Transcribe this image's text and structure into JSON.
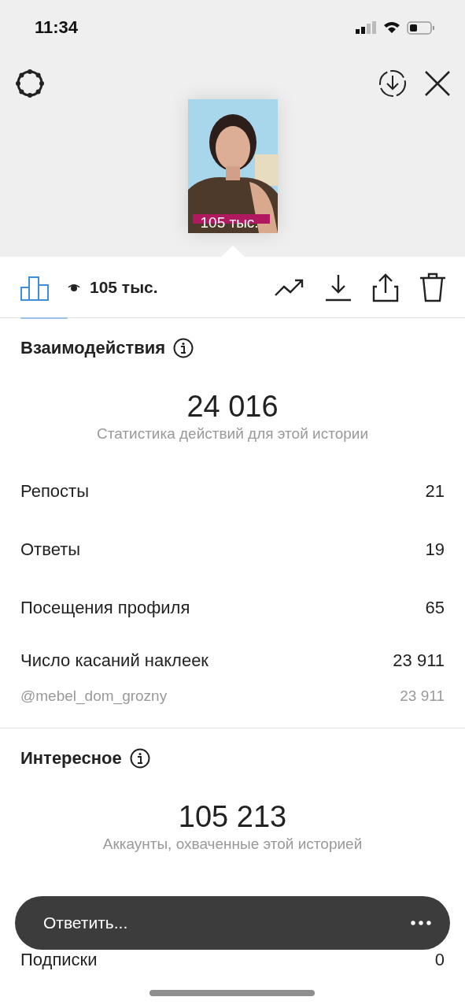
{
  "status_bar": {
    "time": "11:34"
  },
  "story": {
    "views_overlay": "105 тыс."
  },
  "toolbar": {
    "tabs": [
      {
        "kind": "chart",
        "selected": true
      }
    ],
    "views": "105 тыс."
  },
  "sections": [
    {
      "title": "Взаимодействия",
      "total": "24 016",
      "caption": "Статистика действий для этой истории",
      "rows": [
        {
          "kind": "main",
          "label": "Репосты",
          "value": "21"
        },
        {
          "kind": "main",
          "label": "Ответы",
          "value": "19"
        },
        {
          "kind": "main",
          "label": "Посещения профиля",
          "value": "65"
        },
        {
          "kind": "compact",
          "label": "Число касаний наклеек",
          "value": "23 911"
        },
        {
          "kind": "sub",
          "label": "@mebel_dom_grozny",
          "value": "23 911"
        }
      ]
    },
    {
      "title": "Интересное",
      "total": "105 213",
      "caption": "Аккаунты, охваченные этой историей",
      "rows": [
        {
          "kind": "main",
          "label": "Подписки",
          "value": "0"
        }
      ]
    }
  ],
  "reply_bar": {
    "placeholder": "Ответить..."
  }
}
